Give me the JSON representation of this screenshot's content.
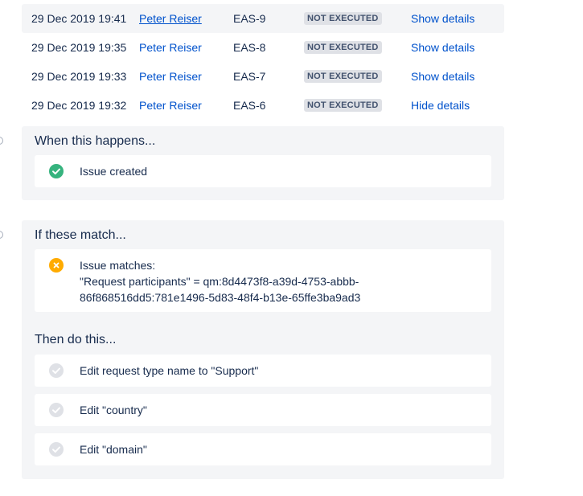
{
  "audit_rows": [
    {
      "date": "29 Dec 2019 19:41",
      "user": "Peter Reiser",
      "key": "EAS-9",
      "status": "NOT EXECUTED",
      "action": "Show details"
    },
    {
      "date": "29 Dec 2019 19:35",
      "user": "Peter Reiser",
      "key": "EAS-8",
      "status": "NOT EXECUTED",
      "action": "Show details"
    },
    {
      "date": "29 Dec 2019 19:33",
      "user": "Peter Reiser",
      "key": "EAS-7",
      "status": "NOT EXECUTED",
      "action": "Show details"
    },
    {
      "date": "29 Dec 2019 19:32",
      "user": "Peter Reiser",
      "key": "EAS-6",
      "status": "NOT EXECUTED",
      "action": "Hide details"
    }
  ],
  "trigger": {
    "title": "When this happens...",
    "item": {
      "icon": "check-circle-icon",
      "label": "Issue created"
    }
  },
  "conditions": {
    "title": "If these match...",
    "item": {
      "icon": "warning-x-icon",
      "line1": "Issue matches:",
      "line2": "\"Request participants\" = qm:8d4473f8-a39d-4753-abbb-",
      "line3": "86f868516dd5:781e1496-5d83-48f4-b13e-65ffe3ba9ad3"
    }
  },
  "actions": {
    "title": "Then do this...",
    "items": [
      {
        "icon": "check-circle-grey-icon",
        "label": "Edit request type name to \"Support\""
      },
      {
        "icon": "check-circle-grey-icon",
        "label": "Edit \"country\""
      },
      {
        "icon": "check-circle-grey-icon",
        "label": "Edit \"domain\""
      }
    ]
  },
  "colors": {
    "success": "#36b37e",
    "warning": "#ffab00",
    "neutral": "#dfe1e6",
    "link": "#0052cc"
  }
}
